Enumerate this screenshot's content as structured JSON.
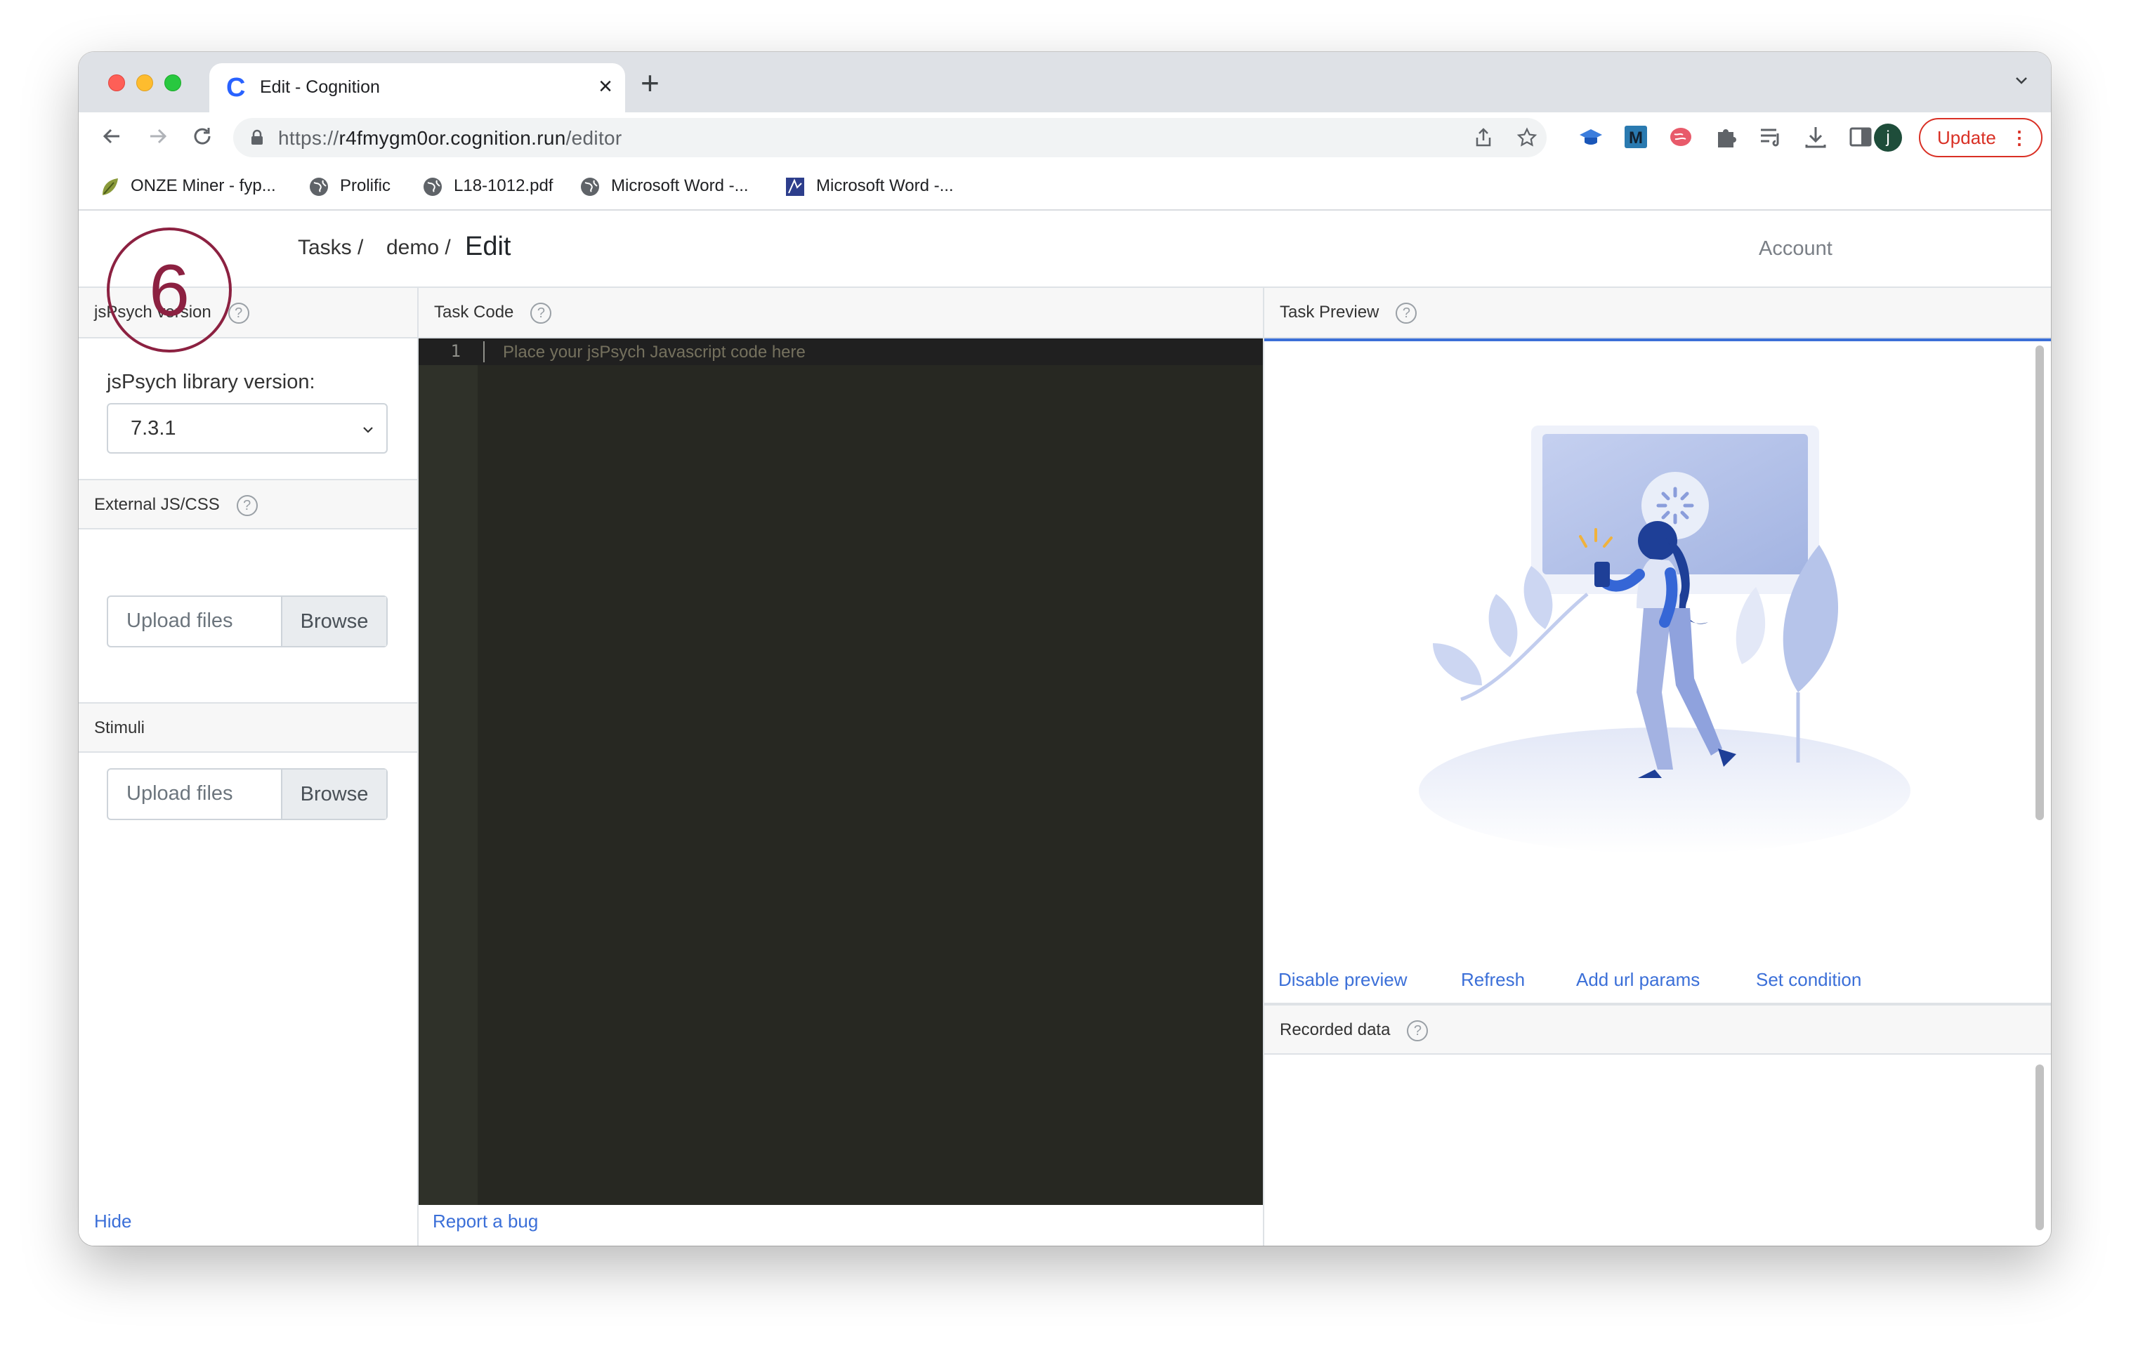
{
  "browser": {
    "tab_title": "Edit - Cognition",
    "url_prefix": "https://",
    "url_host": "r4fmygm0or.cognition.run",
    "url_path": "/editor",
    "update_label": "Update",
    "profile_initial": "j",
    "bookmarks": [
      {
        "label": "ONZE Miner - fyp..."
      },
      {
        "label": "Prolific"
      },
      {
        "label": "L18-1012.pdf"
      },
      {
        "label": "Microsoft Word -..."
      },
      {
        "label": "Microsoft Word -..."
      }
    ]
  },
  "app": {
    "breadcrumb": {
      "tasks": "Tasks /",
      "task": "demo /",
      "current": "Edit"
    },
    "account": "Account",
    "annotation_number": "6",
    "left": {
      "jspsych_header": "jsPsych version",
      "library_label": "jsPsych library version:",
      "library_value": "7.3.1",
      "external_header": "External JS/CSS",
      "stimuli_header": "Stimuli",
      "upload_placeholder": "Upload files",
      "browse_label": "Browse",
      "hide_link": "Hide"
    },
    "middle": {
      "header": "Task Code",
      "line_number": "1",
      "code_placeholder": "Place your jsPsych Javascript code here",
      "report_bug": "Report a bug"
    },
    "right": {
      "preview_header": "Task Preview",
      "links": [
        "Disable preview",
        "Refresh",
        "Add url params",
        "Set condition"
      ],
      "recorded_header": "Recorded data"
    },
    "help_glyph": "?"
  },
  "colors": {
    "accent": "#3b6fd8",
    "annotation": "#8c2141",
    "editor_bg": "#272822"
  }
}
